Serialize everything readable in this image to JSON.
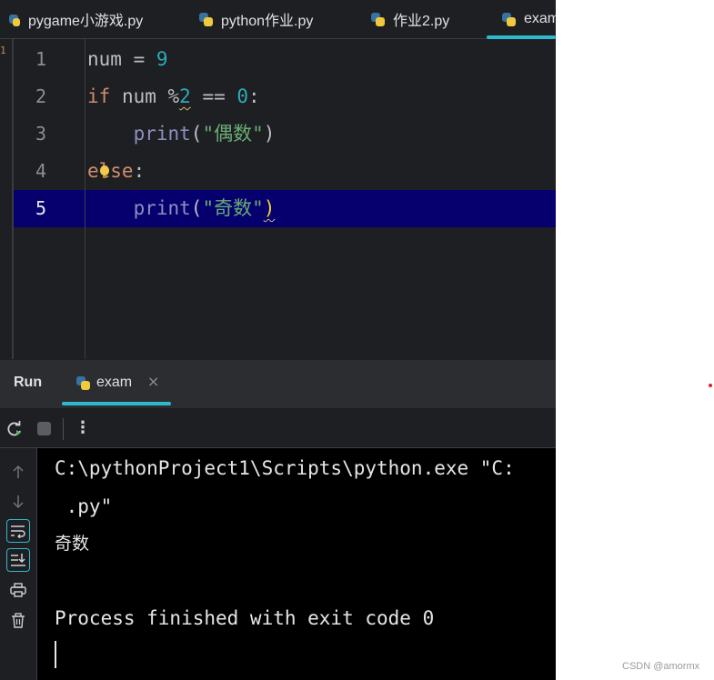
{
  "tabs": [
    {
      "label": "pygame小游戏.py"
    },
    {
      "label": "python作业.py"
    },
    {
      "label": "作业2.py"
    },
    {
      "label": "exam"
    }
  ],
  "gutter_marker": "1",
  "editor": {
    "current_line": 5,
    "lines": [
      {
        "number": "1"
      },
      {
        "number": "2"
      },
      {
        "number": "3"
      },
      {
        "number": "4"
      },
      {
        "number": "5"
      }
    ]
  },
  "run": {
    "title": "Run",
    "tab_label": "exam",
    "close_glyph": "×",
    "more_glyph": "⋮"
  },
  "console": {
    "lines": [
      "C:\\pythonProject1\\Scripts\\python.exe \"C:",
      " .py\"",
      "奇数",
      "",
      "Process finished with exit code 0"
    ]
  },
  "watermark": "CSDN @amormx",
  "colors": {
    "editor_bg": "#1e1f22",
    "current_line_bg": "#05006e",
    "accent": "#2fb9cf",
    "keyword": "#cf8e6d",
    "number": "#2aacb8",
    "function": "#8e8fbf",
    "string": "#6aab73"
  }
}
